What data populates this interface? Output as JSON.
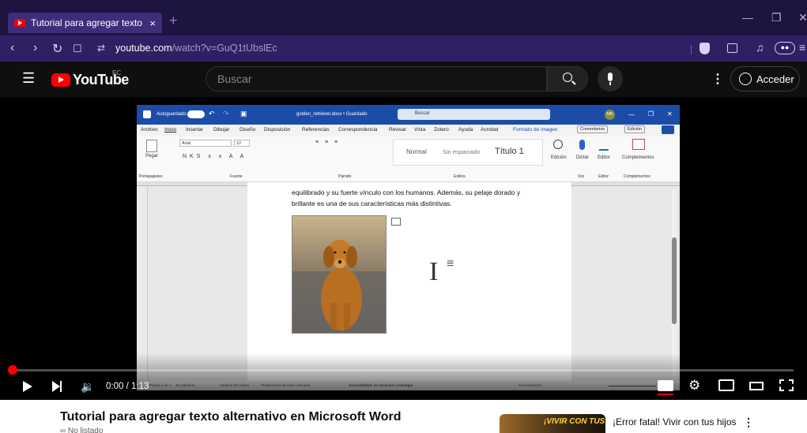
{
  "browser": {
    "tab_title": "Tutorial para agregar texto altern",
    "tab_close": "×",
    "new_tab": "+",
    "url_host": "youtube.com",
    "url_path": "/watch?v=GuQ1tUbslEc"
  },
  "youtube": {
    "logo_text": "YouTube",
    "country_code": "EC",
    "search_placeholder": "Buscar",
    "signin_label": "Acceder"
  },
  "word": {
    "autosave_label": "Autoguardado",
    "doc_title": "golden_retriever.docx • Guardado",
    "search_placeholder": "Buscar",
    "avatar": "MN",
    "ribbon_tabs": [
      "Archivo",
      "Inicio",
      "Insertar",
      "Dibujar",
      "Diseño",
      "Disposición",
      "Referencias",
      "Correspondencia",
      "Revisar",
      "Vista",
      "Zotero",
      "Ayuda",
      "Acrobat",
      "Formato de imagen"
    ],
    "comments_btn": "Comentarios",
    "edit_btn": "Edición",
    "clipboard_label": "Portapapeles",
    "paste_label": "Pegar",
    "font_name": "Arial",
    "font_size": "12",
    "font_group": "Fuente",
    "para_group": "Párrafo",
    "styles": [
      "Normal",
      "Sin espaciado",
      "Título 1"
    ],
    "styles_group": "Estilos",
    "edicion": "Edición",
    "dictar": "Dictar",
    "voz": "Voz",
    "editor": "Editor",
    "complementos": "Complementos",
    "body_line1": "equilibrado y su fuerte vínculo con los humanos. Además, su pelaje dorado y",
    "body_line2": "brillante es una de sus características más distintivas.",
    "status_page": "Página 1 de 1",
    "status_words": "81 palabras",
    "status_lang": "Español (Ecuador)",
    "status_predict": "Predicciones de texto: activado",
    "status_access": "Accesibilidad: es necesario investigar",
    "status_focus": "Concentración"
  },
  "player": {
    "current_time": "0:00",
    "duration": "1:13",
    "progress_fraction": 0.0
  },
  "video": {
    "title": "Tutorial para agregar texto alternativo en Microsoft Word",
    "visibility": "No listado"
  },
  "recommendation": {
    "thumb_text": "¡VIVIR CON TUS",
    "title": "¡Error fatal! Vivir con tus hijos"
  },
  "colors": {
    "browser_frame": "#1e1440",
    "youtube_red": "#ff0000",
    "word_blue": "#1b4da8"
  }
}
